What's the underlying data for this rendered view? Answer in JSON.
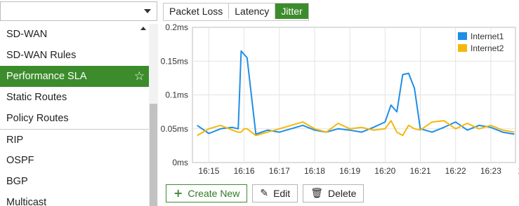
{
  "sidebar": {
    "items": [
      {
        "label": "SD-WAN"
      },
      {
        "label": "SD-WAN Rules"
      },
      {
        "label": "Performance SLA",
        "active": true
      },
      {
        "label": "Static Routes"
      },
      {
        "label": "Policy Routes"
      },
      {
        "label": "RIP"
      },
      {
        "label": "OSPF"
      },
      {
        "label": "BGP"
      },
      {
        "label": "Multicast"
      }
    ]
  },
  "tabs": [
    {
      "label": "Packet Loss"
    },
    {
      "label": "Latency"
    },
    {
      "label": "Jitter",
      "active": true
    }
  ],
  "chart_data": {
    "type": "line",
    "title": "",
    "xlabel": "",
    "ylabel": "",
    "ylim": [
      0,
      0.2
    ],
    "y_ticks": [
      "0ms",
      "0.05ms",
      "0.1ms",
      "0.15ms",
      "0.2ms"
    ],
    "x_ticks": [
      "16:15",
      "16:16",
      "16:17",
      "16:18",
      "16:19",
      "16:20",
      "16:21",
      "16:22",
      "16:23",
      "16:2"
    ],
    "x": [
      "16:14:40",
      "16:15:00",
      "16:15:20",
      "16:15:40",
      "16:15:50",
      "16:15:55",
      "16:16:00",
      "16:16:05",
      "16:16:20",
      "16:16:40",
      "16:17:00",
      "16:17:20",
      "16:17:40",
      "16:18:00",
      "16:18:20",
      "16:18:40",
      "16:19:00",
      "16:19:20",
      "16:19:40",
      "16:20:00",
      "16:20:10",
      "16:20:20",
      "16:20:30",
      "16:20:40",
      "16:20:50",
      "16:21:00",
      "16:21:20",
      "16:21:40",
      "16:22:00",
      "16:22:20",
      "16:22:40",
      "16:23:00",
      "16:23:20",
      "16:23:40"
    ],
    "series": [
      {
        "name": "Internet1",
        "color": "#1f8ee6",
        "values": [
          0.055,
          0.043,
          0.05,
          0.052,
          0.05,
          0.165,
          0.16,
          0.155,
          0.042,
          0.048,
          0.045,
          0.05,
          0.055,
          0.048,
          0.045,
          0.05,
          0.048,
          0.045,
          0.052,
          0.06,
          0.085,
          0.075,
          0.13,
          0.132,
          0.11,
          0.05,
          0.045,
          0.052,
          0.06,
          0.048,
          0.055,
          0.052,
          0.045,
          0.042
        ]
      },
      {
        "name": "Internet2",
        "color": "#f2b90c",
        "values": [
          0.04,
          0.05,
          0.055,
          0.048,
          0.045,
          0.045,
          0.05,
          0.05,
          0.04,
          0.045,
          0.05,
          0.055,
          0.06,
          0.05,
          0.045,
          0.058,
          0.05,
          0.052,
          0.048,
          0.05,
          0.062,
          0.045,
          0.04,
          0.055,
          0.05,
          0.048,
          0.06,
          0.062,
          0.05,
          0.058,
          0.05,
          0.055,
          0.048,
          0.045
        ]
      }
    ],
    "legend_position": "top-right",
    "grid": true
  },
  "toolbar": {
    "create": "Create New",
    "edit": "Edit",
    "delete": "Delete"
  }
}
